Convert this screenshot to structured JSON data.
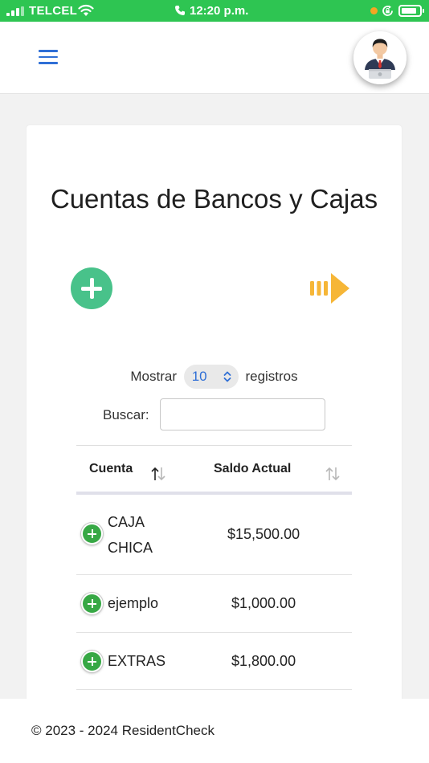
{
  "status_bar": {
    "carrier": "TELCEL",
    "time": "12:20 p.m.",
    "icons": [
      "signal-icon",
      "wifi-icon",
      "phone-icon",
      "rotation-lock-icon",
      "battery-icon"
    ],
    "battery_level": 0.85,
    "bar_color": "#2ec552"
  },
  "navbar": {
    "menu_icon": "hamburger-icon",
    "avatar_icon": "user-avatar-icon",
    "accent": "#2f6fd6"
  },
  "page": {
    "title": "Cuentas de Bancos y Cajas",
    "add_icon": "plus-circle-icon",
    "next_icon": "arrow-right-icon",
    "add_color": "#48c28a",
    "next_color": "#f6b637"
  },
  "length_control": {
    "prefix": "Mostrar",
    "value": "10",
    "suffix": "registros"
  },
  "search": {
    "label": "Buscar:",
    "value": "",
    "placeholder": ""
  },
  "table": {
    "columns": [
      "Cuenta",
      "Saldo Actual"
    ],
    "rows": [
      {
        "name_line1": "CAJA",
        "name_line2": "CHICA",
        "saldo": "$15,500.00"
      },
      {
        "name_line1": "ejemplo",
        "name_line2": "",
        "saldo": "$1,000.00"
      },
      {
        "name_line1": "EXTRAS",
        "name_line2": "",
        "saldo": "$1,800.00"
      }
    ]
  },
  "footer": {
    "text": "© 2023 - 2024 ResidentCheck"
  }
}
